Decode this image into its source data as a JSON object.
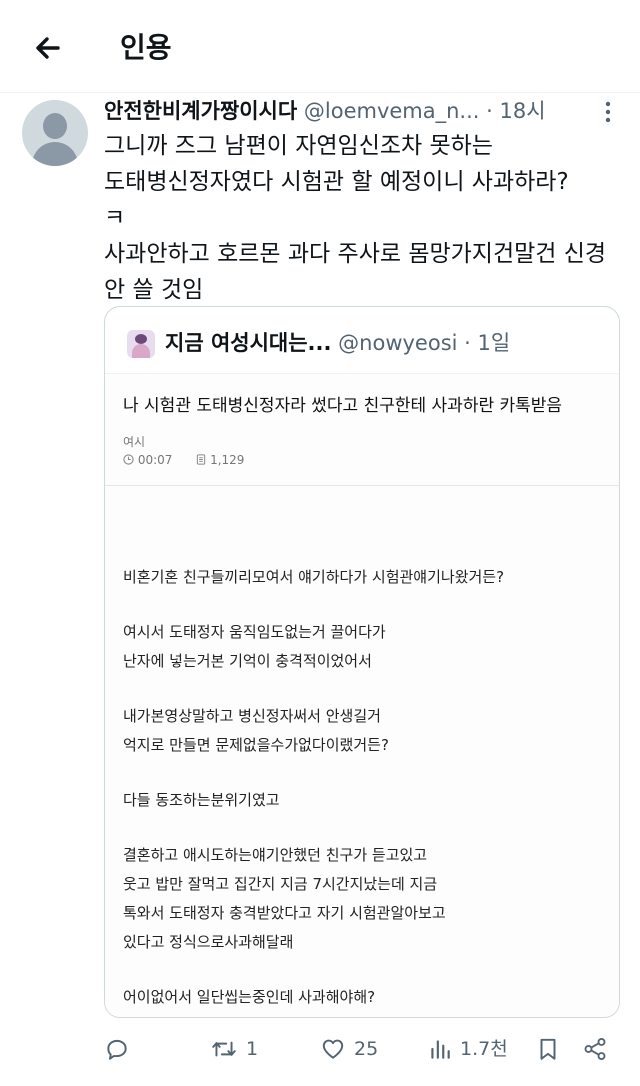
{
  "header": {
    "title": "인용"
  },
  "tweet": {
    "display_name": "안전한비계가짱이시다",
    "handle": "@loemvema_n...",
    "time": "· 18시",
    "lines": [
      "그니까 즈그 남편이 자연임신조차 못하는",
      "도태병신정자였다 시험관 할 예정이니 사과하라?",
      "ㅋ",
      "사과안하고 호르몬 과다 주사로 몸망가지건말건 신경",
      "안 쓸 것임"
    ]
  },
  "quote": {
    "display_name": "지금 여성시대는...",
    "handle": "@nowyeosi",
    "time": "· 1일",
    "post": {
      "title": "나 시험관 도태병신정자라 썼다고 친구한테 사과하란 카톡받음",
      "board": "여시",
      "time": "00:07",
      "views": "1,129",
      "body": [
        "비혼기혼 친구들끼리모여서 얘기하다가 시험관얘기나왔거든?",
        "",
        "여시서 도태정자 움직임도없는거 끌어다가",
        "난자에 넣는거본 기억이 충격적이었어서",
        "",
        "내가본영상말하고 병신정자써서 안생길거",
        "억지로 만들면 문제없을수가없다이랬거든?",
        "",
        "다들 동조하는분위기였고",
        "",
        "결혼하고 애시도하는얘기안했던 친구가 듣고있고",
        "웃고 밥만 잘먹고 집간지 지금 7시간지났는데 지금",
        "톡와서 도태정자 충격받았다고 자기 시험관알아보고",
        "있다고 정식으로사과해달래",
        "",
        "어이없어서 일단씹는중인데 사과해야해?"
      ]
    }
  },
  "actions": {
    "reply_count": "",
    "retweet_count": "1",
    "like_count": "25",
    "view_count": "1.7천"
  },
  "colors": {
    "secondary_text": "#536471",
    "border": "#cfd9de",
    "primary_text": "#0f1419"
  }
}
